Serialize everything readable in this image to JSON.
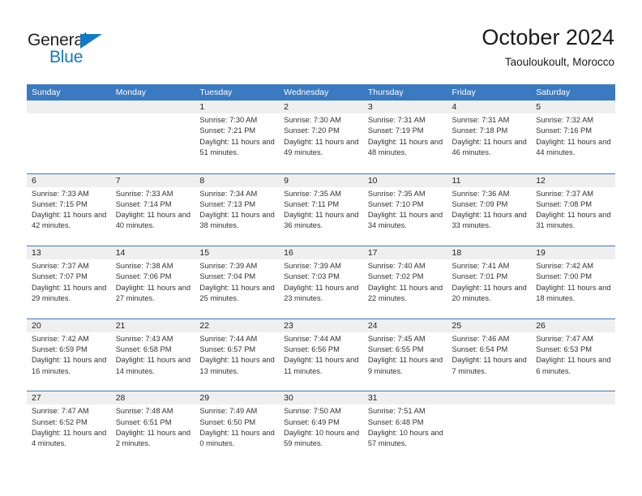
{
  "brand": {
    "name_dark": "General",
    "name_blue": "Blue",
    "accent_color": "#1279c4"
  },
  "header": {
    "title": "October 2024",
    "subtitle": "Taouloukoult, Morocco"
  },
  "theme": {
    "header_row_color": "#3a7ac0",
    "date_bar_color": "#efefef",
    "text_color": "#333333"
  },
  "weekdays": [
    "Sunday",
    "Monday",
    "Tuesday",
    "Wednesday",
    "Thursday",
    "Friday",
    "Saturday"
  ],
  "weeks": [
    [
      {
        "date": "",
        "sunrise": "",
        "sunset": "",
        "daylight": ""
      },
      {
        "date": "",
        "sunrise": "",
        "sunset": "",
        "daylight": ""
      },
      {
        "date": "1",
        "sunrise": "Sunrise: 7:30 AM",
        "sunset": "Sunset: 7:21 PM",
        "daylight": "Daylight: 11 hours and 51 minutes."
      },
      {
        "date": "2",
        "sunrise": "Sunrise: 7:30 AM",
        "sunset": "Sunset: 7:20 PM",
        "daylight": "Daylight: 11 hours and 49 minutes."
      },
      {
        "date": "3",
        "sunrise": "Sunrise: 7:31 AM",
        "sunset": "Sunset: 7:19 PM",
        "daylight": "Daylight: 11 hours and 48 minutes."
      },
      {
        "date": "4",
        "sunrise": "Sunrise: 7:31 AM",
        "sunset": "Sunset: 7:18 PM",
        "daylight": "Daylight: 11 hours and 46 minutes."
      },
      {
        "date": "5",
        "sunrise": "Sunrise: 7:32 AM",
        "sunset": "Sunset: 7:16 PM",
        "daylight": "Daylight: 11 hours and 44 minutes."
      }
    ],
    [
      {
        "date": "6",
        "sunrise": "Sunrise: 7:33 AM",
        "sunset": "Sunset: 7:15 PM",
        "daylight": "Daylight: 11 hours and 42 minutes."
      },
      {
        "date": "7",
        "sunrise": "Sunrise: 7:33 AM",
        "sunset": "Sunset: 7:14 PM",
        "daylight": "Daylight: 11 hours and 40 minutes."
      },
      {
        "date": "8",
        "sunrise": "Sunrise: 7:34 AM",
        "sunset": "Sunset: 7:13 PM",
        "daylight": "Daylight: 11 hours and 38 minutes."
      },
      {
        "date": "9",
        "sunrise": "Sunrise: 7:35 AM",
        "sunset": "Sunset: 7:11 PM",
        "daylight": "Daylight: 11 hours and 36 minutes."
      },
      {
        "date": "10",
        "sunrise": "Sunrise: 7:35 AM",
        "sunset": "Sunset: 7:10 PM",
        "daylight": "Daylight: 11 hours and 34 minutes."
      },
      {
        "date": "11",
        "sunrise": "Sunrise: 7:36 AM",
        "sunset": "Sunset: 7:09 PM",
        "daylight": "Daylight: 11 hours and 33 minutes."
      },
      {
        "date": "12",
        "sunrise": "Sunrise: 7:37 AM",
        "sunset": "Sunset: 7:08 PM",
        "daylight": "Daylight: 11 hours and 31 minutes."
      }
    ],
    [
      {
        "date": "13",
        "sunrise": "Sunrise: 7:37 AM",
        "sunset": "Sunset: 7:07 PM",
        "daylight": "Daylight: 11 hours and 29 minutes."
      },
      {
        "date": "14",
        "sunrise": "Sunrise: 7:38 AM",
        "sunset": "Sunset: 7:06 PM",
        "daylight": "Daylight: 11 hours and 27 minutes."
      },
      {
        "date": "15",
        "sunrise": "Sunrise: 7:39 AM",
        "sunset": "Sunset: 7:04 PM",
        "daylight": "Daylight: 11 hours and 25 minutes."
      },
      {
        "date": "16",
        "sunrise": "Sunrise: 7:39 AM",
        "sunset": "Sunset: 7:03 PM",
        "daylight": "Daylight: 11 hours and 23 minutes."
      },
      {
        "date": "17",
        "sunrise": "Sunrise: 7:40 AM",
        "sunset": "Sunset: 7:02 PM",
        "daylight": "Daylight: 11 hours and 22 minutes."
      },
      {
        "date": "18",
        "sunrise": "Sunrise: 7:41 AM",
        "sunset": "Sunset: 7:01 PM",
        "daylight": "Daylight: 11 hours and 20 minutes."
      },
      {
        "date": "19",
        "sunrise": "Sunrise: 7:42 AM",
        "sunset": "Sunset: 7:00 PM",
        "daylight": "Daylight: 11 hours and 18 minutes."
      }
    ],
    [
      {
        "date": "20",
        "sunrise": "Sunrise: 7:42 AM",
        "sunset": "Sunset: 6:59 PM",
        "daylight": "Daylight: 11 hours and 16 minutes."
      },
      {
        "date": "21",
        "sunrise": "Sunrise: 7:43 AM",
        "sunset": "Sunset: 6:58 PM",
        "daylight": "Daylight: 11 hours and 14 minutes."
      },
      {
        "date": "22",
        "sunrise": "Sunrise: 7:44 AM",
        "sunset": "Sunset: 6:57 PM",
        "daylight": "Daylight: 11 hours and 13 minutes."
      },
      {
        "date": "23",
        "sunrise": "Sunrise: 7:44 AM",
        "sunset": "Sunset: 6:56 PM",
        "daylight": "Daylight: 11 hours and 11 minutes."
      },
      {
        "date": "24",
        "sunrise": "Sunrise: 7:45 AM",
        "sunset": "Sunset: 6:55 PM",
        "daylight": "Daylight: 11 hours and 9 minutes."
      },
      {
        "date": "25",
        "sunrise": "Sunrise: 7:46 AM",
        "sunset": "Sunset: 6:54 PM",
        "daylight": "Daylight: 11 hours and 7 minutes."
      },
      {
        "date": "26",
        "sunrise": "Sunrise: 7:47 AM",
        "sunset": "Sunset: 6:53 PM",
        "daylight": "Daylight: 11 hours and 6 minutes."
      }
    ],
    [
      {
        "date": "27",
        "sunrise": "Sunrise: 7:47 AM",
        "sunset": "Sunset: 6:52 PM",
        "daylight": "Daylight: 11 hours and 4 minutes."
      },
      {
        "date": "28",
        "sunrise": "Sunrise: 7:48 AM",
        "sunset": "Sunset: 6:51 PM",
        "daylight": "Daylight: 11 hours and 2 minutes."
      },
      {
        "date": "29",
        "sunrise": "Sunrise: 7:49 AM",
        "sunset": "Sunset: 6:50 PM",
        "daylight": "Daylight: 11 hours and 0 minutes."
      },
      {
        "date": "30",
        "sunrise": "Sunrise: 7:50 AM",
        "sunset": "Sunset: 6:49 PM",
        "daylight": "Daylight: 10 hours and 59 minutes."
      },
      {
        "date": "31",
        "sunrise": "Sunrise: 7:51 AM",
        "sunset": "Sunset: 6:48 PM",
        "daylight": "Daylight: 10 hours and 57 minutes."
      },
      {
        "date": "",
        "sunrise": "",
        "sunset": "",
        "daylight": ""
      },
      {
        "date": "",
        "sunrise": "",
        "sunset": "",
        "daylight": ""
      }
    ]
  ]
}
